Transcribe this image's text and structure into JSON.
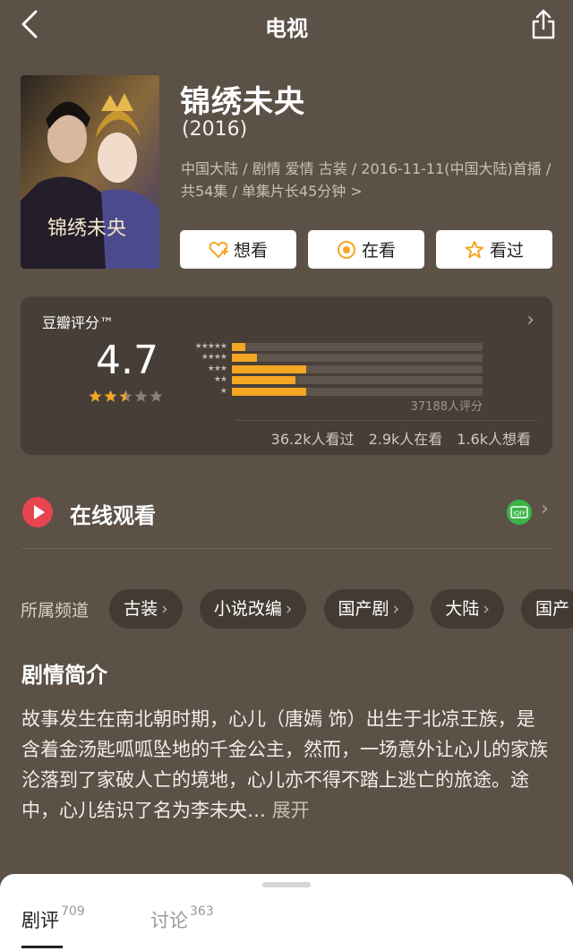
{
  "header": {
    "title": "电视",
    "back_icon": "back-chevron-icon",
    "share_icon": "share-icon"
  },
  "show": {
    "title": "锦绣未央",
    "year": "(2016)",
    "meta": "中国大陆 / 剧情 爱情 古装 / 2016-11-11(中国大陆)首播 / 共54集 / 单集片长45分钟 >"
  },
  "actions": [
    {
      "label": "想看",
      "icon": "heart-plus-icon"
    },
    {
      "label": "在看",
      "icon": "watching-icon"
    },
    {
      "label": "看过",
      "icon": "star-outline-icon"
    }
  ],
  "rating": {
    "label": "豆瓣评分™",
    "score": "4.7",
    "stars": 2.5,
    "distribution": [
      {
        "stars": "★★★★★",
        "fraction": 0.055
      },
      {
        "stars": "★★★★",
        "fraction": 0.1
      },
      {
        "stars": "★★★",
        "fraction": 0.295
      },
      {
        "stars": "★★",
        "fraction": 0.255
      },
      {
        "stars": "★",
        "fraction": 0.295
      }
    ],
    "count": "37188人评分",
    "watched": "36.2k人看过",
    "watching": "2.9k人在看",
    "want": "1.6k人想看",
    "colors": {
      "bar": "#f5a623",
      "track": "#5e554c"
    }
  },
  "online": {
    "label": "在线观看",
    "provider_icon": "iqiyi-icon"
  },
  "channels": {
    "label": "所属频道",
    "items": [
      "古装",
      "小说改编",
      "国产剧",
      "大陆",
      "国产"
    ]
  },
  "synopsis": {
    "title": "剧情简介",
    "text": "故事发生在南北朝时期，心儿（唐嫣 饰）出生于北凉王族，是含着金汤匙呱呱坠地的千金公主，然而，一场意外让心儿的家族沦落到了家破人亡的境地，心儿亦不得不踏上逃亡的旅途。途中，心儿结识了名为李未央…",
    "expand": "展开"
  },
  "bottom_tabs": {
    "reviews_label": "剧评",
    "reviews_count": "709",
    "discuss_label": "讨论",
    "discuss_count": "363"
  }
}
